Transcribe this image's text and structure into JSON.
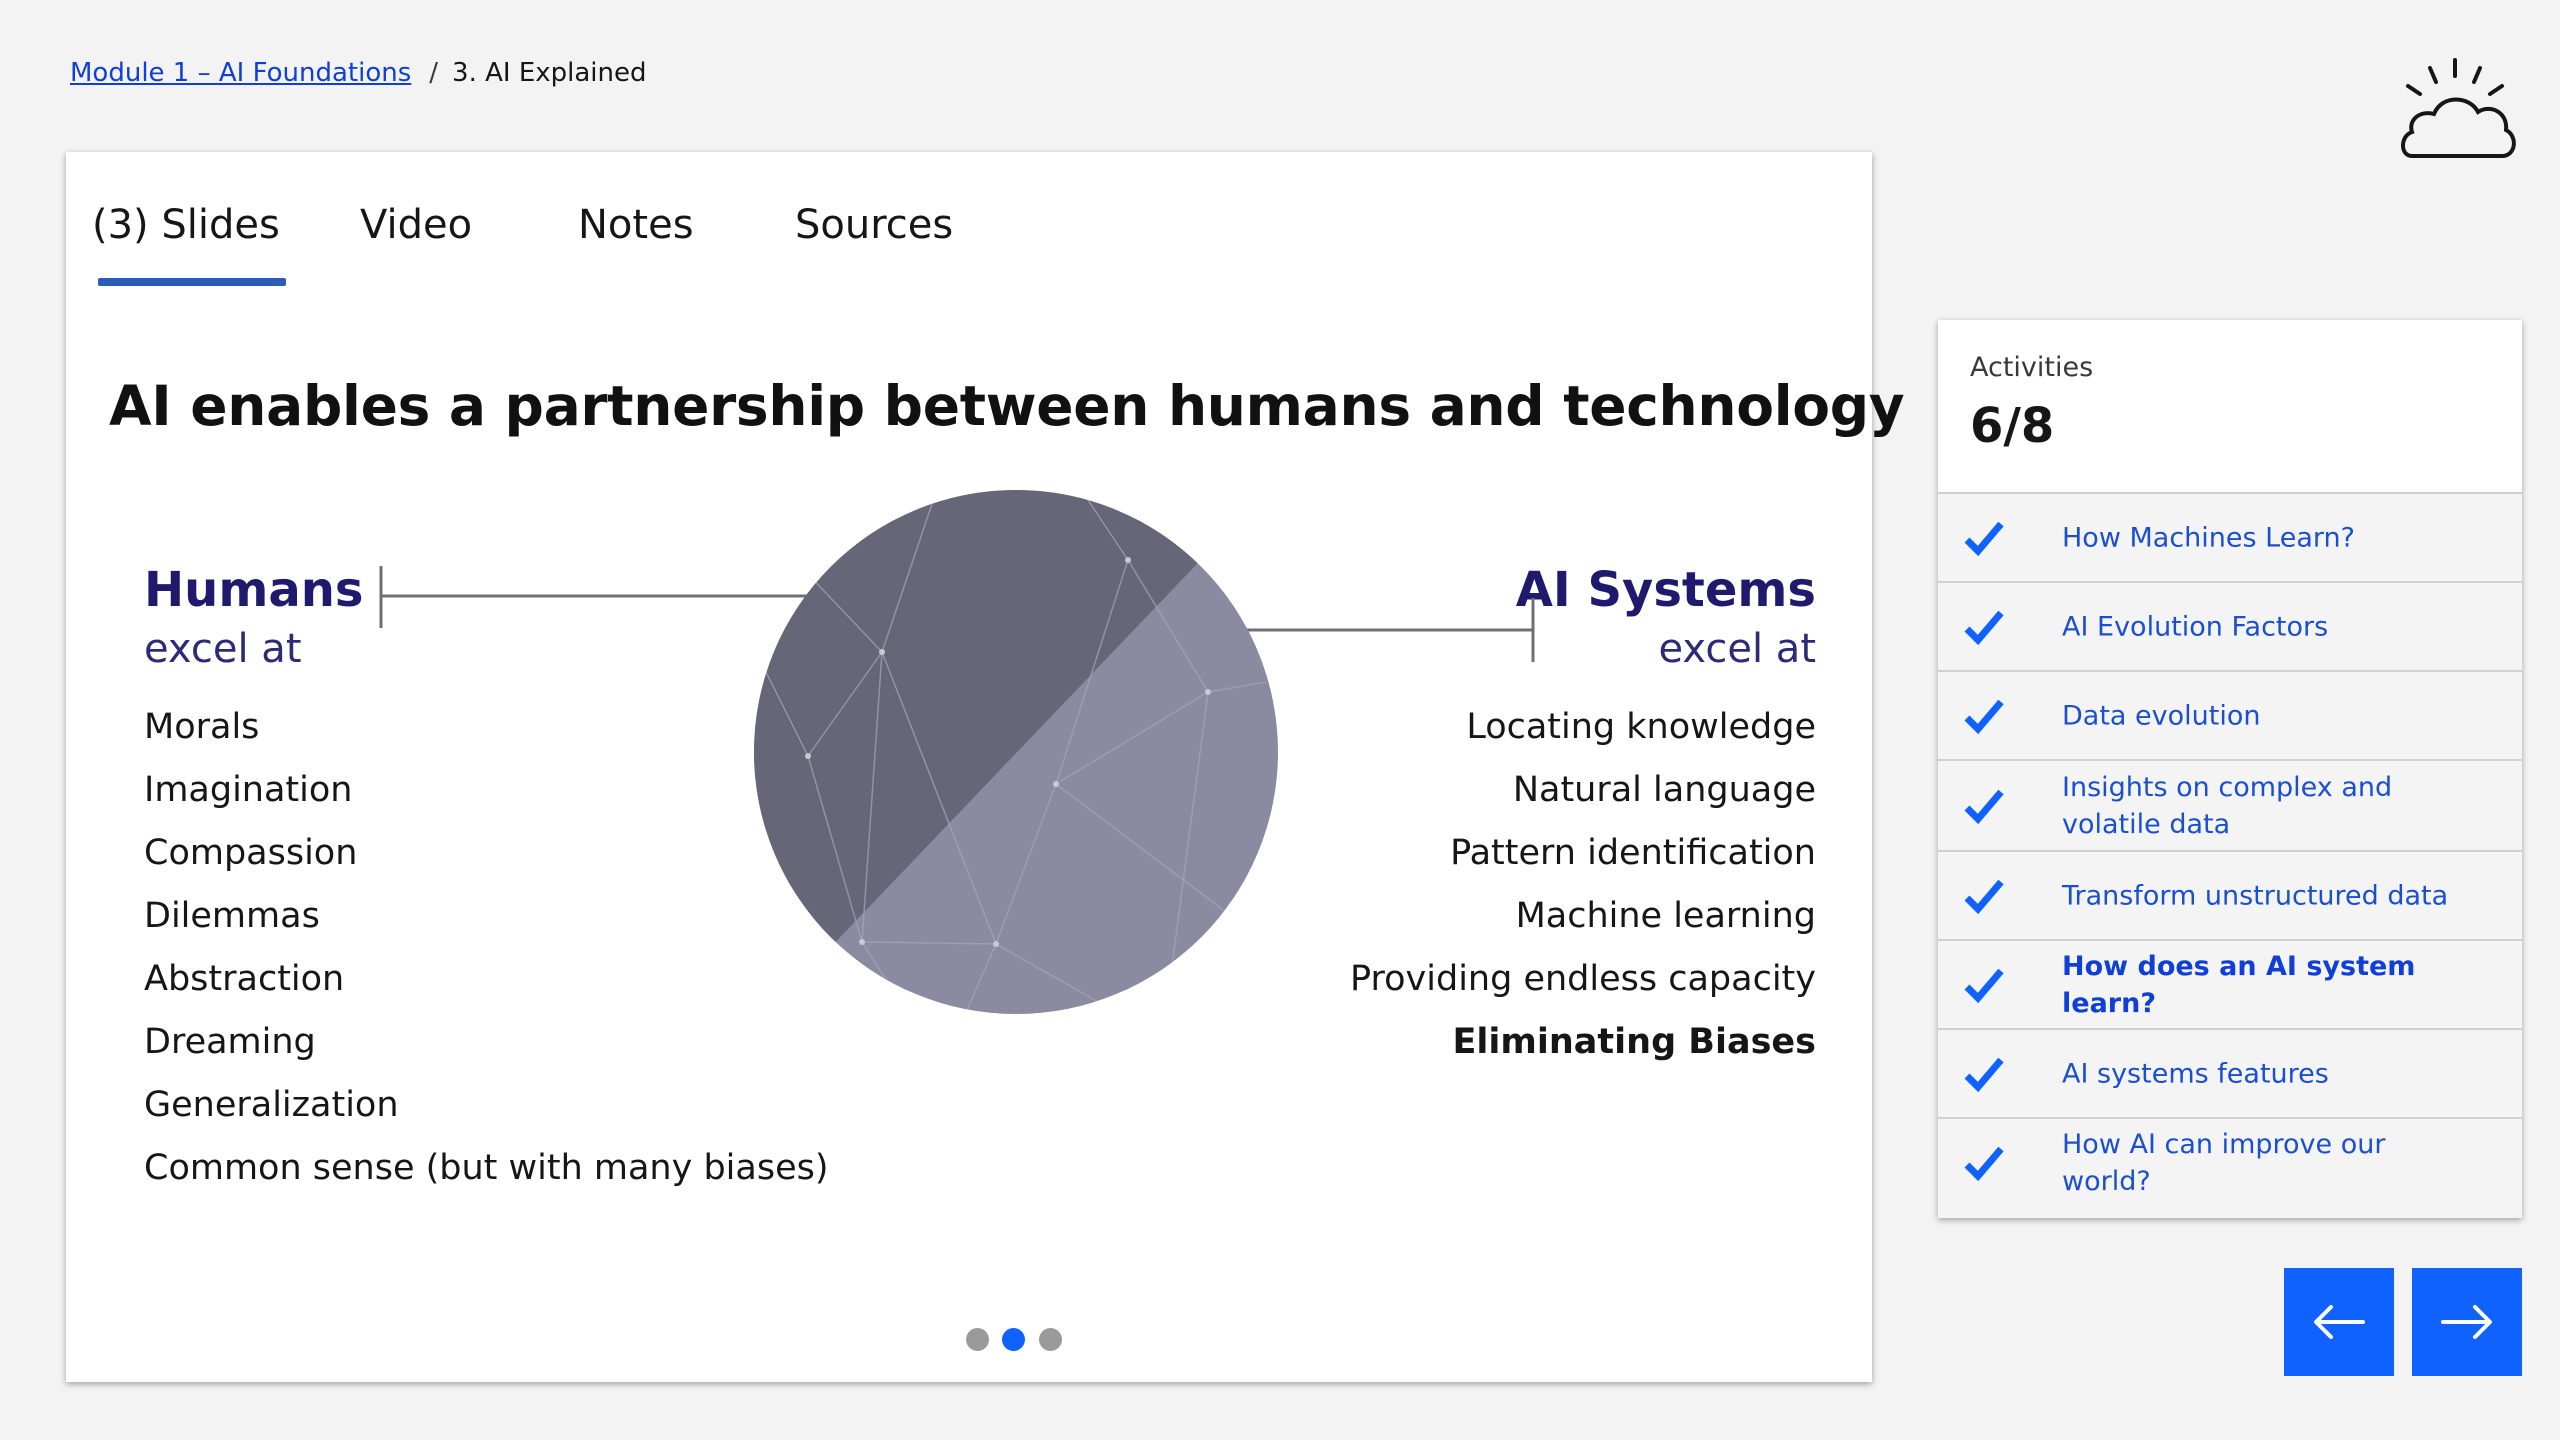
{
  "breadcrumb": {
    "module_link": "Module 1 – AI Foundations",
    "separator": "/",
    "current": "3. AI Explained"
  },
  "tabs": [
    {
      "label": "(3) Slides",
      "active": true
    },
    {
      "label": "Video",
      "active": false
    },
    {
      "label": "Notes",
      "active": false
    },
    {
      "label": "Sources",
      "active": false
    }
  ],
  "slide": {
    "title": "AI enables a partnership between humans and technology",
    "humans": {
      "heading": "Humans",
      "sub": "excel at",
      "items": [
        "Morals",
        "Imagination",
        "Compassion",
        "Dilemmas",
        "Abstraction",
        "Dreaming",
        "Generalization",
        "Common sense (but with many biases)"
      ]
    },
    "ai": {
      "heading": "AI Systems",
      "sub": "excel at",
      "items": [
        "Locating knowledge",
        "Natural language",
        "Pattern identification",
        "Machine learning",
        "Providing endless capacity",
        "Eliminating Biases"
      ],
      "bold_item": "Eliminating Biases"
    },
    "pager": {
      "total": 3,
      "current": 2
    }
  },
  "activities": {
    "label": "Activities",
    "count": "6/8",
    "items": [
      {
        "label": "How Machines Learn?",
        "done": true
      },
      {
        "label": "AI Evolution Factors",
        "done": true
      },
      {
        "label": "Data evolution",
        "done": true
      },
      {
        "label": "Insights on complex and volatile data",
        "done": true
      },
      {
        "label": "Transform unstructured data",
        "done": true
      },
      {
        "label": "How does an AI system learn?",
        "done": true,
        "current": true
      },
      {
        "label": "AI systems features",
        "done": true
      },
      {
        "label": "How AI can improve our world?",
        "done": true
      }
    ]
  },
  "nav": {
    "prev_icon": "arrow-left-icon",
    "next_icon": "arrow-right-icon"
  },
  "colors": {
    "accent": "#0f62fe",
    "heading": "#1f1a6e",
    "link": "#1a4fd1",
    "circle_dark": "#676578",
    "circle_light": "#8b8aa0"
  },
  "logo_icon": "cloud-sun-icon"
}
